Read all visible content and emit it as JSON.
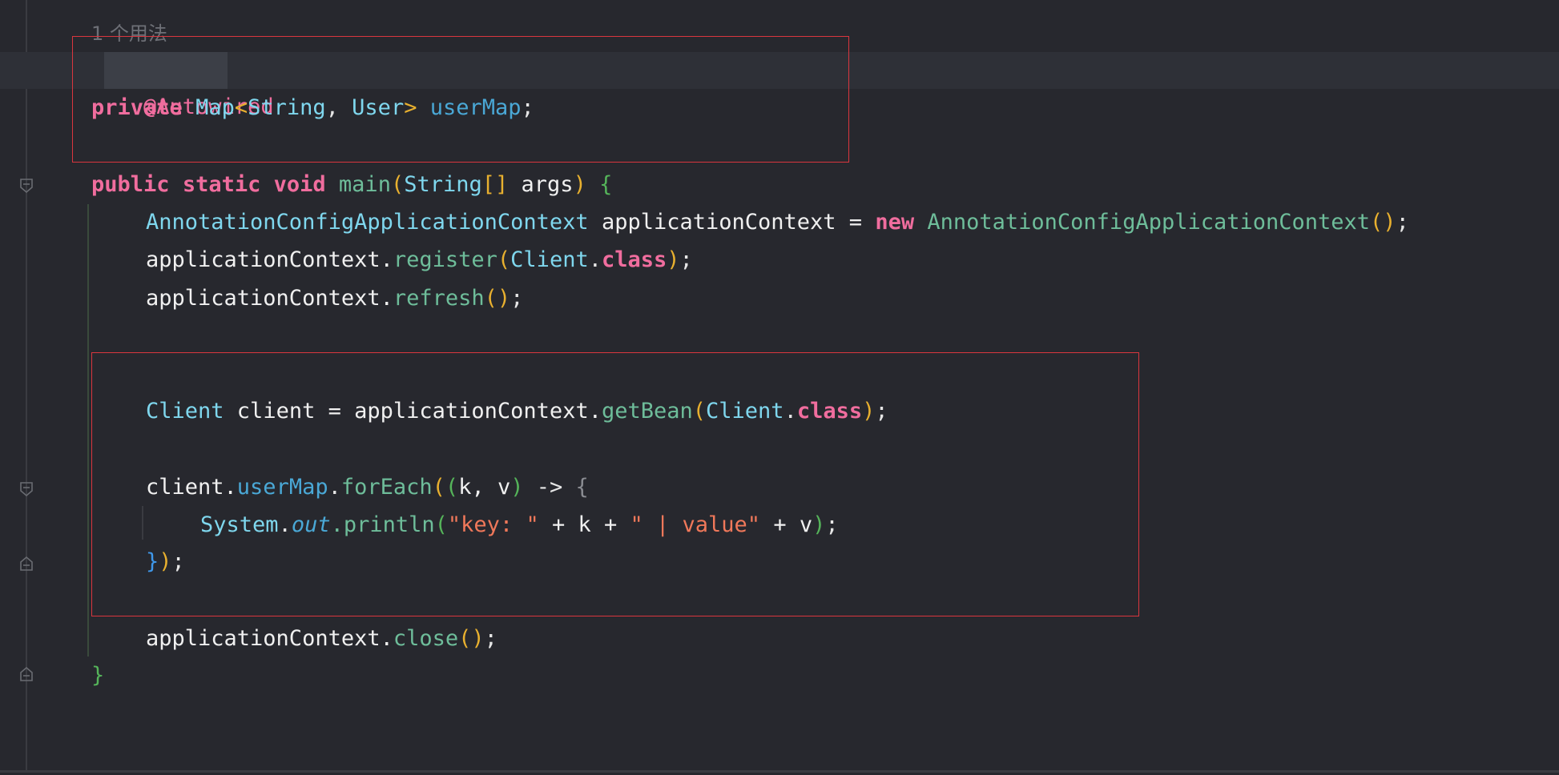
{
  "hint": "1 个用法",
  "code": {
    "l1_ann": "@Autowired",
    "l2_private": "private",
    "l2_map": "Map",
    "l2_lt": "<",
    "l2_string": "String",
    "l2_comma": ", ",
    "l2_user": "User",
    "l2_gt": ">",
    "l2_field": "userMap",
    "l2_semi": ";",
    "l3_public": "public",
    "l3_static": "static",
    "l3_void": "void",
    "l3_main": "main",
    "l3_paren_open": "(",
    "l3_string": "String",
    "l3_arr": "[]",
    "l3_args": " args",
    "l3_paren_close": ")",
    "l3_brace": "{",
    "l4_type": "AnnotationConfigApplicationContext",
    "l4_var": " applicationContext = ",
    "l4_new": "new",
    "l4_ctor": "AnnotationConfigApplicationContext",
    "l4_parens": "()",
    "l4_semi": ";",
    "l5_obj": "applicationContext.",
    "l5_method": "register",
    "l5_po": "(",
    "l5_client": "Client",
    "l5_dot": ".",
    "l5_class": "class",
    "l5_pc": ")",
    "l5_semi": ";",
    "l6_obj": "applicationContext.",
    "l6_method": "refresh",
    "l6_parens": "()",
    "l6_semi": ";",
    "l7_type": "Client",
    "l7_mid": " client = applicationContext.",
    "l7_method": "getBean",
    "l7_po": "(",
    "l7_client": "Client",
    "l7_dot": ".",
    "l7_class": "class",
    "l7_pc": ")",
    "l7_semi": ";",
    "l8_obj": "client.",
    "l8_field": "userMap",
    "l8_dot": ".",
    "l8_method": "forEach",
    "l8_po": "(",
    "l8_po2": "(",
    "l8_params": "k, v",
    "l8_pc2": ")",
    "l8_arrow": " -> ",
    "l8_brace": "{",
    "l9_system": "System",
    "l9_dot": ".",
    "l9_out": "out",
    "l9_println": ".println",
    "l9_po": "(",
    "l9_str1": "\"key: \"",
    "l9_mid1": " + k + ",
    "l9_str2": "\" | value\"",
    "l9_mid2": " + v",
    "l9_pc": ")",
    "l9_semi": ";",
    "l10_brace": "}",
    "l10_pc": ")",
    "l10_semi": ";",
    "l11_obj": "applicationContext.",
    "l11_method": "close",
    "l11_parens": "()",
    "l11_semi": ";",
    "l12_brace": "}"
  },
  "colors": {
    "background": "#27282e",
    "keyword": "#f06d9e",
    "type": "#7fd7ee",
    "method": "#6ebd9a",
    "field": "#4aa8d6",
    "string": "#f0785a",
    "highlight_box": "#d9363e"
  }
}
